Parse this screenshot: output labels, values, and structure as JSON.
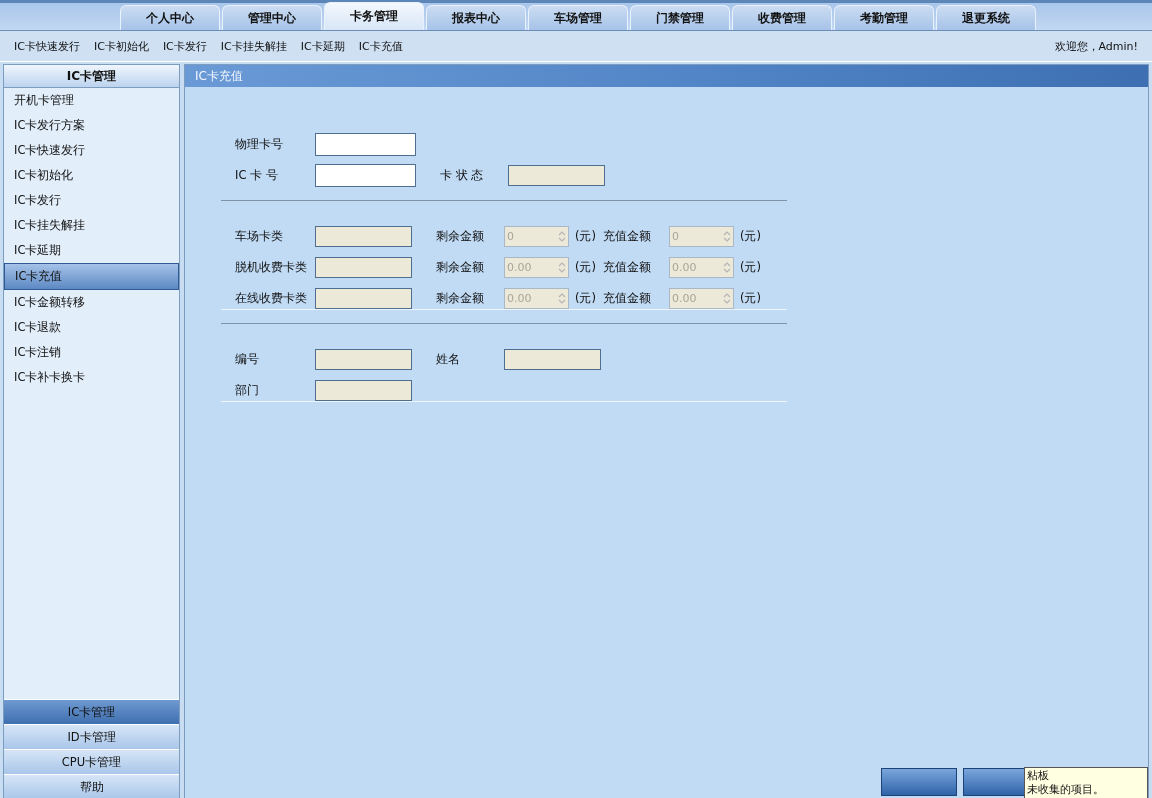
{
  "tabs": [
    {
      "label": "个人中心",
      "selected": false
    },
    {
      "label": "管理中心",
      "selected": false
    },
    {
      "label": "卡务管理",
      "selected": true
    },
    {
      "label": "报表中心",
      "selected": false
    },
    {
      "label": "车场管理",
      "selected": false
    },
    {
      "label": "门禁管理",
      "selected": false
    },
    {
      "label": "收费管理",
      "selected": false
    },
    {
      "label": "考勤管理",
      "selected": false
    },
    {
      "label": "退更系统",
      "selected": false
    }
  ],
  "subnav": [
    "IC卡快速发行",
    "IC卡初始化",
    "IC卡发行",
    "IC卡挂失解挂",
    "IC卡延期",
    "IC卡充值"
  ],
  "welcome": "欢迎您，Admin!",
  "sidebar": {
    "title": "IC卡管理",
    "items": [
      {
        "label": "开机卡管理",
        "selected": false
      },
      {
        "label": "IC卡发行方案",
        "selected": false
      },
      {
        "label": "IC卡快速发行",
        "selected": false
      },
      {
        "label": "IC卡初始化",
        "selected": false
      },
      {
        "label": "IC卡发行",
        "selected": false
      },
      {
        "label": "IC卡挂失解挂",
        "selected": false
      },
      {
        "label": "IC卡延期",
        "selected": false
      },
      {
        "label": "IC卡充值",
        "selected": true
      },
      {
        "label": "IC卡金额转移",
        "selected": false
      },
      {
        "label": "IC卡退款",
        "selected": false
      },
      {
        "label": "IC卡注销",
        "selected": false
      },
      {
        "label": "IC卡补卡换卡",
        "selected": false
      }
    ]
  },
  "accordion": [
    {
      "label": "IC卡管理",
      "selected": true
    },
    {
      "label": "ID卡管理",
      "selected": false
    },
    {
      "label": "CPU卡管理",
      "selected": false
    },
    {
      "label": "帮助",
      "selected": false
    }
  ],
  "panel": {
    "title": "IC卡充值",
    "sections": [
      [
        [
          {
            "label": "物理卡号",
            "kind": "text"
          }
        ],
        [
          {
            "label": "IC 卡 号",
            "kind": "text"
          },
          {
            "label": "卡 状 态",
            "kind": "readonly"
          }
        ]
      ],
      [
        [
          {
            "label": "车场卡类",
            "kind": "readonly"
          },
          {
            "label": "剩余金额",
            "kind": "spinner",
            "value": "0",
            "unit": "(元)"
          },
          {
            "label": "充值金额",
            "kind": "spinner",
            "value": "0",
            "unit": "(元)"
          }
        ],
        [
          {
            "label": "脱机收费卡类",
            "kind": "readonly"
          },
          {
            "label": "剩余金额",
            "kind": "spinner",
            "value": "0.00",
            "unit": "(元)"
          },
          {
            "label": "充值金额",
            "kind": "spinner",
            "value": "0.00",
            "unit": "(元)"
          }
        ],
        [
          {
            "label": "在线收费卡类",
            "kind": "readonly"
          },
          {
            "label": "剩余金额",
            "kind": "spinner",
            "value": "0.00",
            "unit": "(元)"
          },
          {
            "label": "充值金额",
            "kind": "spinner",
            "value": "0.00",
            "unit": "(元)"
          }
        ]
      ],
      [
        [
          {
            "label": "编号",
            "kind": "readonly"
          },
          {
            "label": "姓名",
            "kind": "readonly"
          }
        ],
        [
          {
            "label": "部门",
            "kind": "readonly"
          }
        ]
      ]
    ]
  },
  "tooltip": {
    "lines": [
      "粘板",
      "未收集的项目。"
    ]
  }
}
